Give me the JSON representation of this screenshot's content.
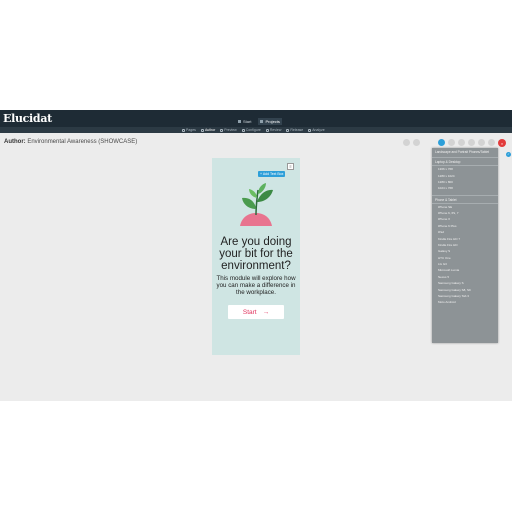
{
  "app": {
    "logo": "Elucidat"
  },
  "topnav": [
    {
      "label": "Start",
      "icon": "home-icon",
      "active": false
    },
    {
      "label": "Projects",
      "icon": "grid-icon",
      "active": true
    }
  ],
  "subnav": [
    {
      "label": "Pages",
      "icon": "pages-icon",
      "active": false
    },
    {
      "label": "Author",
      "icon": "pencil-icon",
      "active": true
    },
    {
      "label": "Preview",
      "icon": "eye-icon",
      "active": false
    },
    {
      "label": "Configure",
      "icon": "gear-icon",
      "active": false
    },
    {
      "label": "Review",
      "icon": "chat-icon",
      "active": false
    },
    {
      "label": "Release",
      "icon": "cloud-icon",
      "active": false
    },
    {
      "label": "Analyze",
      "icon": "chart-icon",
      "active": false
    }
  ],
  "page": {
    "label": "Author:",
    "project": "Environmental Awareness (SHOWCASE)"
  },
  "toolbar": {
    "close": "×"
  },
  "dropdown": {
    "header_lines": [
      "Landscape and Portrait Phones/Tablet"
    ],
    "sections": [
      {
        "title": "Laptop & Desktop",
        "items": [
          "1366 x 768",
          "1280 x 1024",
          "1280 x 800",
          "1024 x 768"
        ]
      },
      {
        "title": "Phone & Tablet",
        "items": [
          "iPhone SE",
          "iPhone 6, 6S, 7",
          "iPhone X",
          "iPhone 6 Plus",
          "iPad",
          "Kindle Fire HD 7",
          "Kindle Fire HD",
          "Galaxy S",
          "HTC One",
          "LG G3",
          "Microsoft Lumia",
          "Nexus 5",
          "Samsung Galaxy S",
          "Samsung Galaxy S8, S9",
          "Samsung Galaxy Tab 3",
          "Moto Android"
        ]
      }
    ]
  },
  "card": {
    "menu_icon": "≡",
    "add_text_box": "+ Add Text Box",
    "title": "Are you doing your bit for the environment?",
    "body": "This module will explore how you can make a difference in the workplace.",
    "start_label": "Start",
    "start_arrow": "→"
  }
}
